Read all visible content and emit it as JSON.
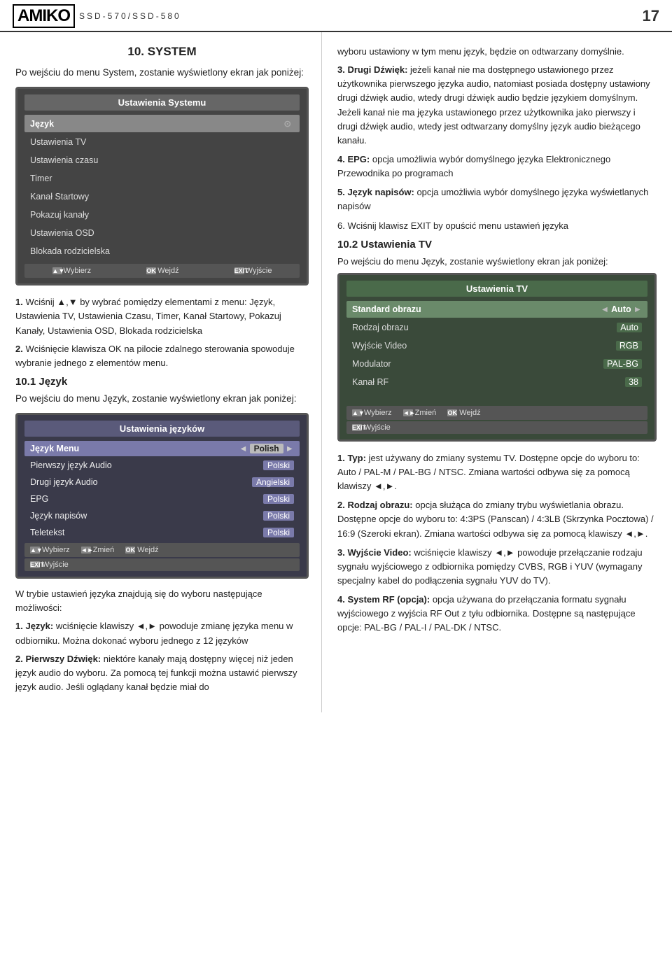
{
  "header": {
    "logo": "AMIKO",
    "model": "SSD-570/SSD-580",
    "page_number": "17"
  },
  "left_column": {
    "section_title": "10. SYSTEM",
    "intro": "Po wejściu do menu System, zostanie wyświetlony ekran jak poniżej:",
    "system_screen": {
      "title": "Ustawienia Systemu",
      "items": [
        {
          "label": "Język",
          "value": "",
          "selected": true
        },
        {
          "label": "Ustawienia TV",
          "value": ""
        },
        {
          "label": "Ustawienia czasu",
          "value": ""
        },
        {
          "label": "Timer",
          "value": ""
        },
        {
          "label": "Kanał Startowy",
          "value": ""
        },
        {
          "label": "Pokazuj kanały",
          "value": ""
        },
        {
          "label": "Ustawienia OSD",
          "value": ""
        },
        {
          "label": "Blokada rodzicielska",
          "value": ""
        }
      ],
      "footer": [
        {
          "icon": "▲▼",
          "label": "Wybierz"
        },
        {
          "icon": "OK",
          "label": "Wejdź"
        },
        {
          "icon": "EXIT",
          "label": "Wyjście"
        }
      ]
    },
    "steps_intro": [
      {
        "num": "1.",
        "bold": "",
        "text": "Wciśnij ▲,▼ by wybrać pomiędzy elementami z menu: Język, Ustawienia TV, Ustawienia Czasu, Timer, Kanał Startowy, Pokazuj Kanały, Ustawienia OSD, Blokada rodzicielska"
      },
      {
        "num": "2.",
        "bold": "",
        "text": "Wciśnięcie klawisza OK na pilocie zdalnego sterowania spowoduje wybranie jednego z elementów menu."
      }
    ],
    "lang_section_title": "10.1 Język",
    "lang_intro": "Po wejściu do menu Język, zostanie wyświetlony ekran jak poniżej:",
    "lang_screen": {
      "title": "Ustawienia języków",
      "rows": [
        {
          "label": "Język Menu",
          "value": "Polish",
          "selected": true,
          "has_arrows": true
        },
        {
          "label": "Pierwszy język Audio",
          "value": "Polski",
          "selected": false
        },
        {
          "label": "Drugi język Audio",
          "value": "Angielski",
          "selected": false
        },
        {
          "label": "EPG",
          "value": "Polski",
          "selected": false
        },
        {
          "label": "Język napisów",
          "value": "Polski",
          "selected": false
        },
        {
          "label": "Teletekst",
          "value": "Polski",
          "selected": false
        }
      ],
      "footer": [
        {
          "icon": "▲▼",
          "label": "Wybierz"
        },
        {
          "icon": "◄►",
          "label": "Zmień"
        },
        {
          "icon": "OK",
          "label": "Wejdź"
        }
      ],
      "exit_footer": [
        {
          "icon": "EXIT",
          "label": "Wyjście"
        }
      ]
    },
    "lang_body": "W trybie ustawień języka znajdują się do wyboru następujące możliwości:",
    "lang_items": [
      {
        "num": "1.",
        "bold": "Język:",
        "text": " wciśnięcie klawiszy ◄,► powoduje zmianę języka menu w odbiorniku. Można dokonać wyboru jednego z 12 języków"
      },
      {
        "num": "2.",
        "bold": "Pierwszy Dźwięk:",
        "text": " niektóre kanały mają dostępny więcej niż jeden język audio do wyboru. Za pomocą tej funkcji można ustawić pierwszy język audio. Jeśli oglądany kanał będzie miał do"
      }
    ]
  },
  "right_column": {
    "body_text_1": "wyboru ustawiony w tym menu język, będzie on odtwarzany domyślnie.",
    "numbered_items": [
      {
        "num": "3.",
        "bold": "Drugi Dźwięk:",
        "text": " jeżeli kanał nie ma dostępnego ustawionego przez użytkownika pierwszego języka audio, natomiast posiada dostępny ustawiony drugi dźwięk audio, wtedy drugi dźwięk audio będzie językiem domyślnym. Jeżeli kanał nie ma języka ustawionego przez użytkownika jako pierwszy i drugi dźwięk audio, wtedy jest odtwarzany domyślny język audio bieżącego kanału."
      },
      {
        "num": "4.",
        "bold": "EPG:",
        "text": " opcja umożliwia wybór domyślnego języka Elektronicznego Przewodnika po programach"
      },
      {
        "num": "5.",
        "bold": "Język napisów:",
        "text": " opcja umożliwia wybór domyślnego języka wyświetlanych napisów"
      },
      {
        "num": "6.",
        "bold": "",
        "text": "Wciśnij klawisz EXIT by opuścić menu ustawień języka"
      }
    ],
    "tv_section_title": "10.2 Ustawienia TV",
    "tv_intro": "Po wejściu do menu Język, zostanie wyświetlony ekran jak poniżej:",
    "tv_screen": {
      "title": "Ustawienia TV",
      "rows": [
        {
          "label": "Standard obrazu",
          "value": "Auto",
          "selected": true
        },
        {
          "label": "Rodzaj obrazu",
          "value": "Auto",
          "selected": false
        },
        {
          "label": "Wyjście Video",
          "value": "RGB",
          "selected": false
        },
        {
          "label": "Modulator",
          "value": "PAL-BG",
          "selected": false
        },
        {
          "label": "Kanał RF",
          "value": "38",
          "selected": false
        }
      ],
      "footer": [
        {
          "icon": "▲▼",
          "label": "Wybierz"
        },
        {
          "icon": "◄►",
          "label": "Zmień"
        },
        {
          "icon": "OK",
          "label": "Wejdź"
        }
      ],
      "exit_footer": [
        {
          "icon": "EXIT",
          "label": "Wyjście"
        }
      ]
    },
    "tv_items": [
      {
        "num": "1.",
        "bold": "Typ:",
        "text": " jest używany do zmiany systemu TV. Dostępne opcje do wyboru to: Auto / PAL-M / PAL-BG / NTSC. Zmiana wartości odbywa się za pomocą klawiszy ◄,►."
      },
      {
        "num": "2.",
        "bold": "Rodzaj obrazu:",
        "text": " opcja służąca do zmiany trybu wyświetlania obrazu. Dostępne opcje do wyboru to: 4:3PS (Panscan) / 4:3LB (Skrzynka Pocztowa) / 16:9 (Szeroki ekran). Zmiana wartości odbywa się za pomocą klawiszy ◄,►."
      },
      {
        "num": "3.",
        "bold": "Wyjście Video:",
        "text": " wciśnięcie klawiszy ◄,► powoduje przełączanie rodzaju sygnału wyjściowego z odbiornika pomiędzy CVBS, RGB i YUV (wymagany specjalny kabel do podłączenia sygnału YUV do TV)."
      },
      {
        "num": "4.",
        "bold": "System RF (opcja):",
        "text": " opcja używana do przełączania formatu sygnału wyjściowego z wyjścia RF Out z tyłu odbiornika. Dostępne są następujące opcje: PAL-BG / PAL-I / PAL-DK / NTSC."
      }
    ]
  }
}
